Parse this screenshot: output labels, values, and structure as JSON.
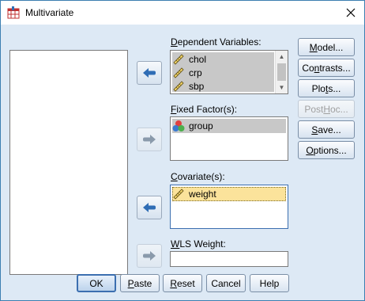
{
  "window": {
    "title": "Multivariate"
  },
  "dependent": {
    "label_u": "D",
    "label_rest": "ependent Variables:",
    "items": [
      {
        "name": "chol"
      },
      {
        "name": "crp"
      },
      {
        "name": "sbp"
      }
    ]
  },
  "fixed": {
    "label_u": "F",
    "label_rest": "ixed Factor(s):",
    "items": [
      {
        "name": "group"
      }
    ]
  },
  "covariate": {
    "label_u": "C",
    "label_rest": "ovariate(s):",
    "items": [
      {
        "name": "weight"
      }
    ]
  },
  "wls": {
    "label_u": "W",
    "label_rest": "LS Weight:",
    "value": ""
  },
  "side_buttons": {
    "model": {
      "u": "M",
      "rest": "odel..."
    },
    "contrasts": {
      "pre": "Co",
      "u": "n",
      "rest": "trasts..."
    },
    "plots": {
      "pre": "Plo",
      "u": "t",
      "rest": "s..."
    },
    "posthoc": {
      "pre": "Post ",
      "u": "H",
      "rest": "oc..."
    },
    "save": {
      "u": "S",
      "rest": "ave..."
    },
    "options": {
      "u": "O",
      "rest": "ptions..."
    }
  },
  "bottom_buttons": {
    "ok": "OK",
    "paste": {
      "u": "P",
      "rest": "aste"
    },
    "reset": {
      "u": "R",
      "rest": "eset"
    },
    "cancel": "Cancel",
    "help": "Help"
  },
  "colors": {
    "dialog_bg": "#dde9f5",
    "selected_gray": "#c8c8c8",
    "selected_yellow": "#fbe39b",
    "arrow_blue": "#2f6db5",
    "arrow_gray": "#8a9aab"
  }
}
